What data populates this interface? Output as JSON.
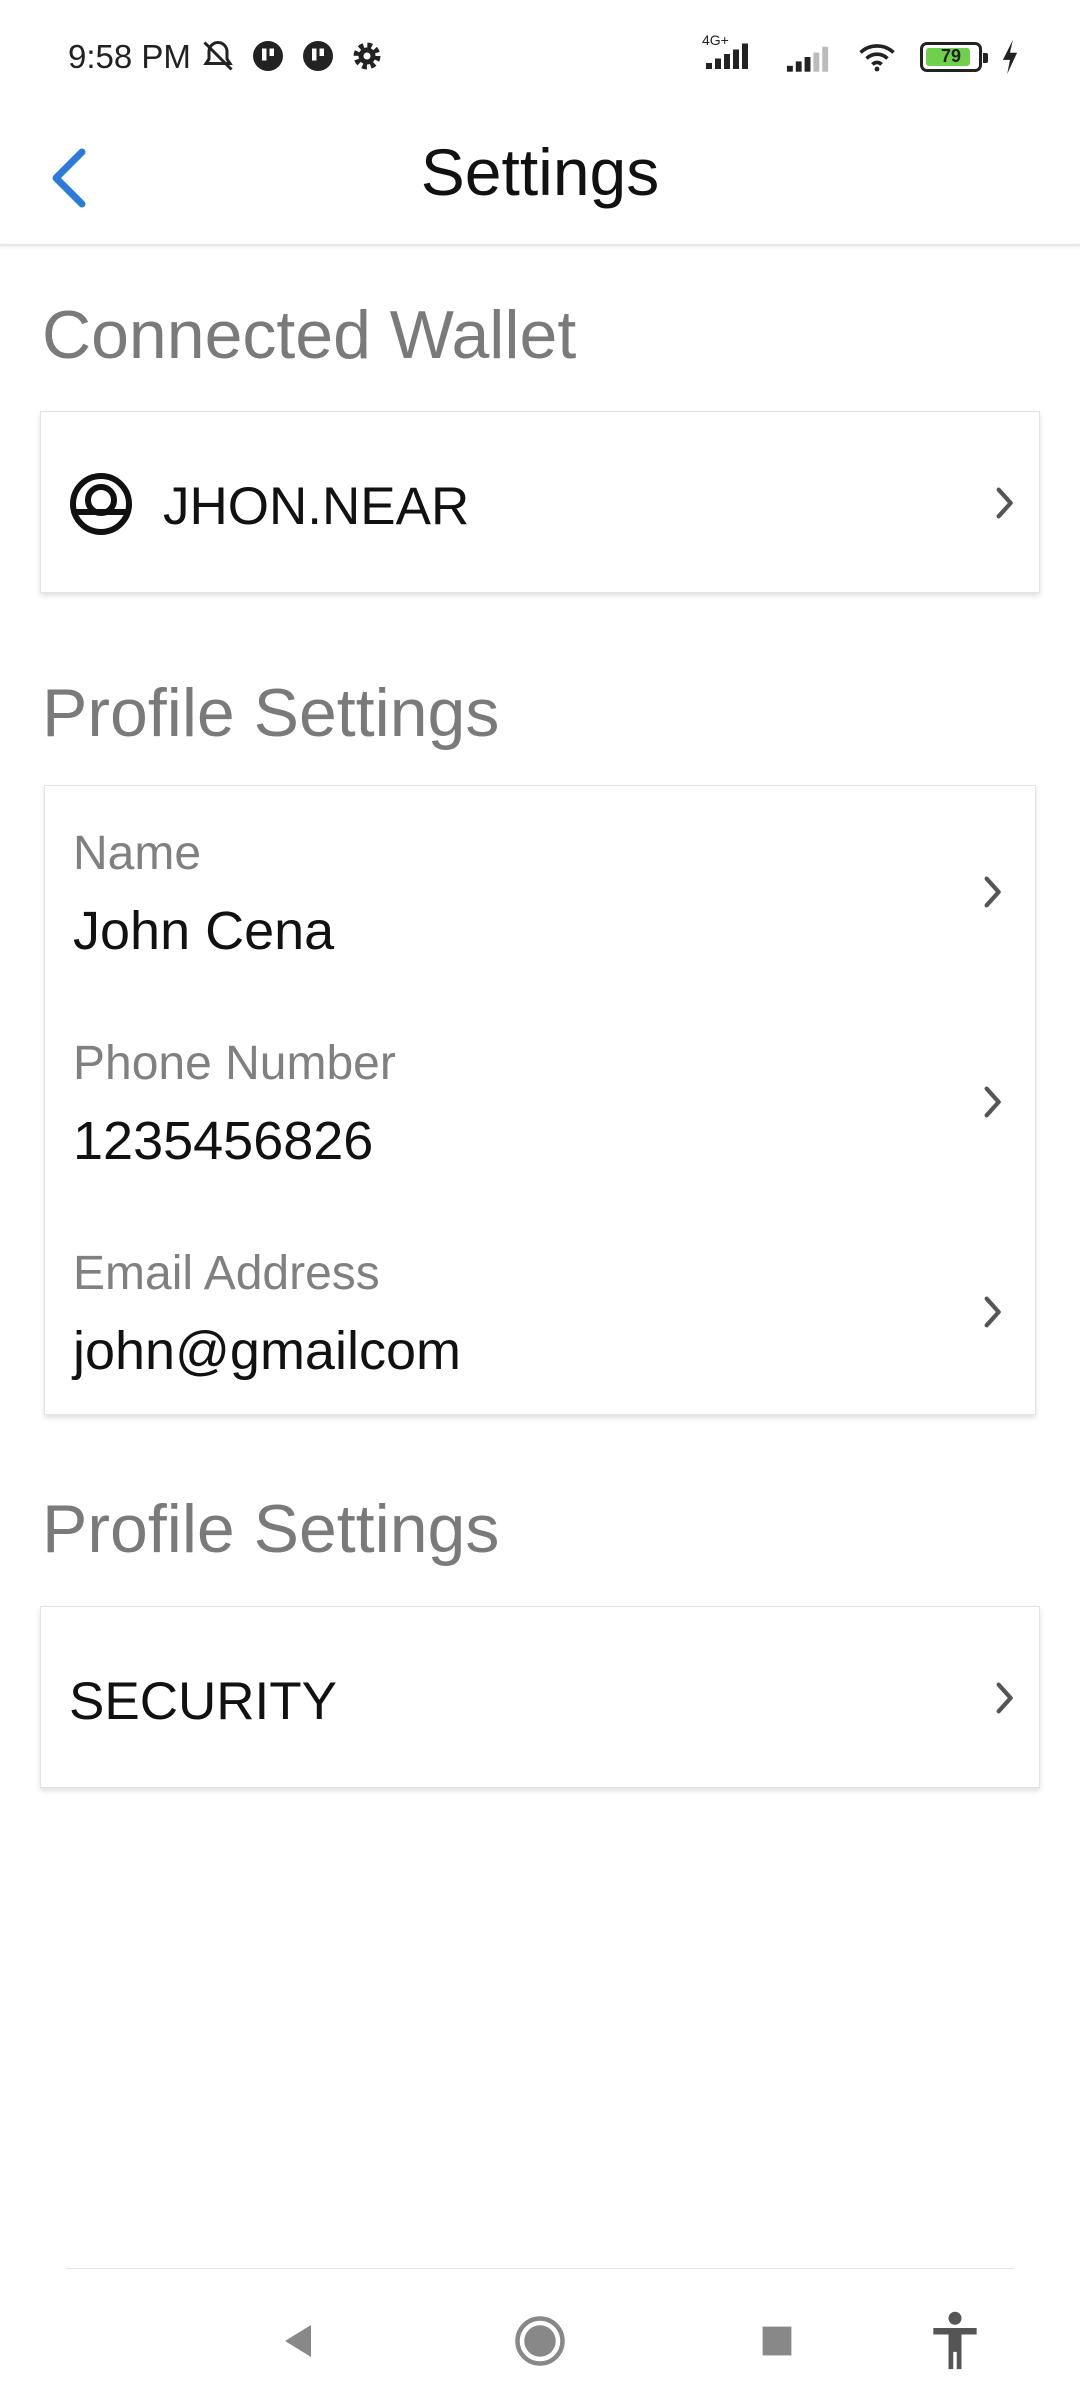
{
  "status_bar": {
    "time": "9:58 PM",
    "network_type": "4G+",
    "battery_level": "79",
    "battery_color": "#6ed04b",
    "icons": [
      "mute-icon",
      "app-icon",
      "app-icon",
      "settings-gear-icon",
      "signal-icon",
      "signal-icon",
      "wifi-icon",
      "battery-icon",
      "charging-icon"
    ]
  },
  "app_bar": {
    "title": "Settings",
    "back_icon": "chevron-left-icon",
    "accent_color": "#2b7bd8"
  },
  "connected_wallet": {
    "section_title": "Connected Wallet",
    "account": "JHON.NEAR",
    "icon": "wallet-account-icon"
  },
  "profile": {
    "section_title": "Profile Settings",
    "fields": [
      {
        "label": "Name",
        "value": "John Cena"
      },
      {
        "label": "Phone Number",
        "value": "1235456826"
      },
      {
        "label": "Email Address",
        "value": "john@gmailcom"
      }
    ]
  },
  "security": {
    "section_title": "Profile Settings",
    "label": "SECURITY"
  },
  "nav_bar": {
    "buttons": [
      "back-triangle-icon",
      "home-circle-icon",
      "recents-square-icon",
      "accessibility-icon"
    ]
  }
}
